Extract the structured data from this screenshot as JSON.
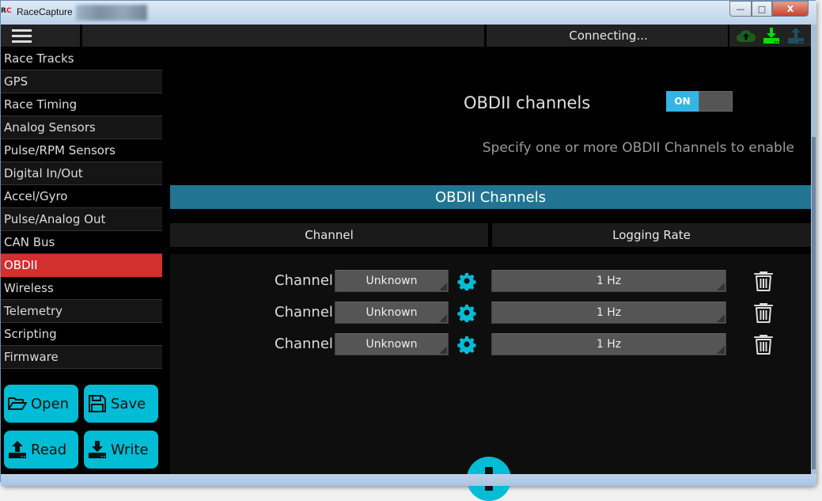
{
  "window": {
    "title": "RaceCapture",
    "logo_text": "RC",
    "controls": {
      "minimize": "—",
      "maximize": "□",
      "close": "X"
    }
  },
  "topbar": {
    "status": "Connecting...",
    "icons": [
      {
        "name": "cloud-upload-icon",
        "color": "#1b5e20"
      },
      {
        "name": "download-icon",
        "color": "#00e000"
      },
      {
        "name": "upload-icon",
        "color": "#1e4f5e"
      }
    ]
  },
  "sidebar": {
    "items": [
      {
        "label": "Race Tracks"
      },
      {
        "label": "GPS"
      },
      {
        "label": "Race Timing"
      },
      {
        "label": "Analog Sensors"
      },
      {
        "label": "Pulse/RPM Sensors"
      },
      {
        "label": "Digital In/Out"
      },
      {
        "label": "Accel/Gyro"
      },
      {
        "label": "Pulse/Analog Out"
      },
      {
        "label": "CAN Bus"
      },
      {
        "label": "OBDII"
      },
      {
        "label": "Wireless"
      },
      {
        "label": "Telemetry"
      },
      {
        "label": "Scripting"
      },
      {
        "label": "Firmware"
      }
    ],
    "active_index": 9,
    "active_color": "#d32f2f",
    "buttons": {
      "open": "Open",
      "save": "Save",
      "read": "Read",
      "write": "Write"
    }
  },
  "main": {
    "title": "OBDII channels",
    "toggle": {
      "label": "ON",
      "state": true
    },
    "hint": "Specify one or more OBDII Channels to enable",
    "section_title": "OBDII Channels",
    "columns": {
      "channel": "Channel",
      "rate": "Logging Rate"
    },
    "rows": [
      {
        "label": "Channel",
        "channel": "Unknown",
        "rate": "1 Hz"
      },
      {
        "label": "Channel",
        "channel": "Unknown",
        "rate": "1 Hz"
      },
      {
        "label": "Channel",
        "channel": "Unknown",
        "rate": "1 Hz"
      }
    ],
    "accent_color": "#00bcd4",
    "section_color": "#217592"
  }
}
